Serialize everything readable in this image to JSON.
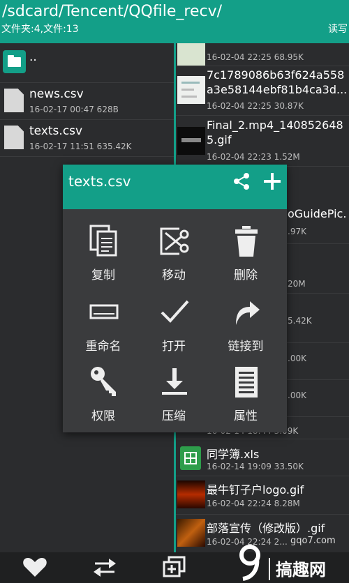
{
  "header": {
    "path": "/sdcard/Tencent/QQfile_recv/",
    "counts": "文件夹:4,文件:13",
    "mode": "读写"
  },
  "left_pane": {
    "parent": "..",
    "files": [
      {
        "name": "news.csv",
        "meta": "16-02-17 00:47  628B"
      },
      {
        "name": "texts.csv",
        "meta": "16-02-17 11:51  635.42K"
      }
    ]
  },
  "right_pane": {
    "rows": [
      {
        "name_line1": "",
        "name_line2": "",
        "meta": "16-02-04 22:25  68.95K",
        "icon": "screenshot-thumbnail"
      },
      {
        "name_line1": "7c1789086b63f624a558",
        "name_line2": "a3e58144ebf81b4ca3d...",
        "meta": "16-02-04 22:25  30.87K",
        "icon": "screenshot-thumbnail"
      },
      {
        "name_line1": "Final_2.mp4_140852648",
        "name_line2": "5.gif",
        "meta": "16-02-04 22:23  1.52M",
        "icon": "gif-thumbnail"
      },
      {
        "name_line1": "oGuidePic.",
        "name_line2": "",
        "meta": ".97K",
        "icon": "image-thumbnail"
      },
      {
        "name_line1": "",
        "name_line2": "",
        "meta": "20M",
        "icon": "image-thumbnail"
      },
      {
        "name_line1": "",
        "name_line2": "",
        "meta": "5.42K",
        "icon": "image-thumbnail"
      },
      {
        "name_line1": "",
        "name_line2": "",
        "meta": ".00K",
        "icon": "image-thumbnail"
      },
      {
        "name_line1": "",
        "name_line2": "",
        "meta": ".00K",
        "icon": "image-thumbnail"
      },
      {
        "name_line1": "",
        "name_line2": "",
        "meta": "16-02-14 18:44  3.09K",
        "icon": "image-thumbnail"
      },
      {
        "name_line1": "同学簿.xls",
        "name_line2": "",
        "meta": "16-02-14 19:09  33.50K",
        "icon": "spreadsheet-icon"
      },
      {
        "name_line1": "最牛钉子户logo.gif",
        "name_line2": "",
        "meta": "16-02-04 22:24  8.28M",
        "icon": "gif-thumbnail"
      },
      {
        "name_line1": "部落宣传（修改版）.gif",
        "name_line2": "",
        "meta": "16-02-04 22:24  2...",
        "icon": "gif-thumbnail"
      }
    ]
  },
  "dialog": {
    "title": "texts.csv",
    "actions": [
      {
        "label": "复制",
        "icon": "copy-icon"
      },
      {
        "label": "移动",
        "icon": "cut-icon"
      },
      {
        "label": "删除",
        "icon": "trash-icon"
      },
      {
        "label": "重命名",
        "icon": "rename-icon"
      },
      {
        "label": "打开",
        "icon": "check-icon"
      },
      {
        "label": "链接到",
        "icon": "link-arrow-icon"
      },
      {
        "label": "权限",
        "icon": "key-icon"
      },
      {
        "label": "压缩",
        "icon": "download-icon"
      },
      {
        "label": "属性",
        "icon": "document-icon"
      }
    ]
  },
  "watermark": {
    "site": "gqo7.com",
    "brand": "搞趣网"
  },
  "colors": {
    "accent": "#139f88",
    "background": "#2b2c2e",
    "dialog": "#3a3b3d"
  }
}
